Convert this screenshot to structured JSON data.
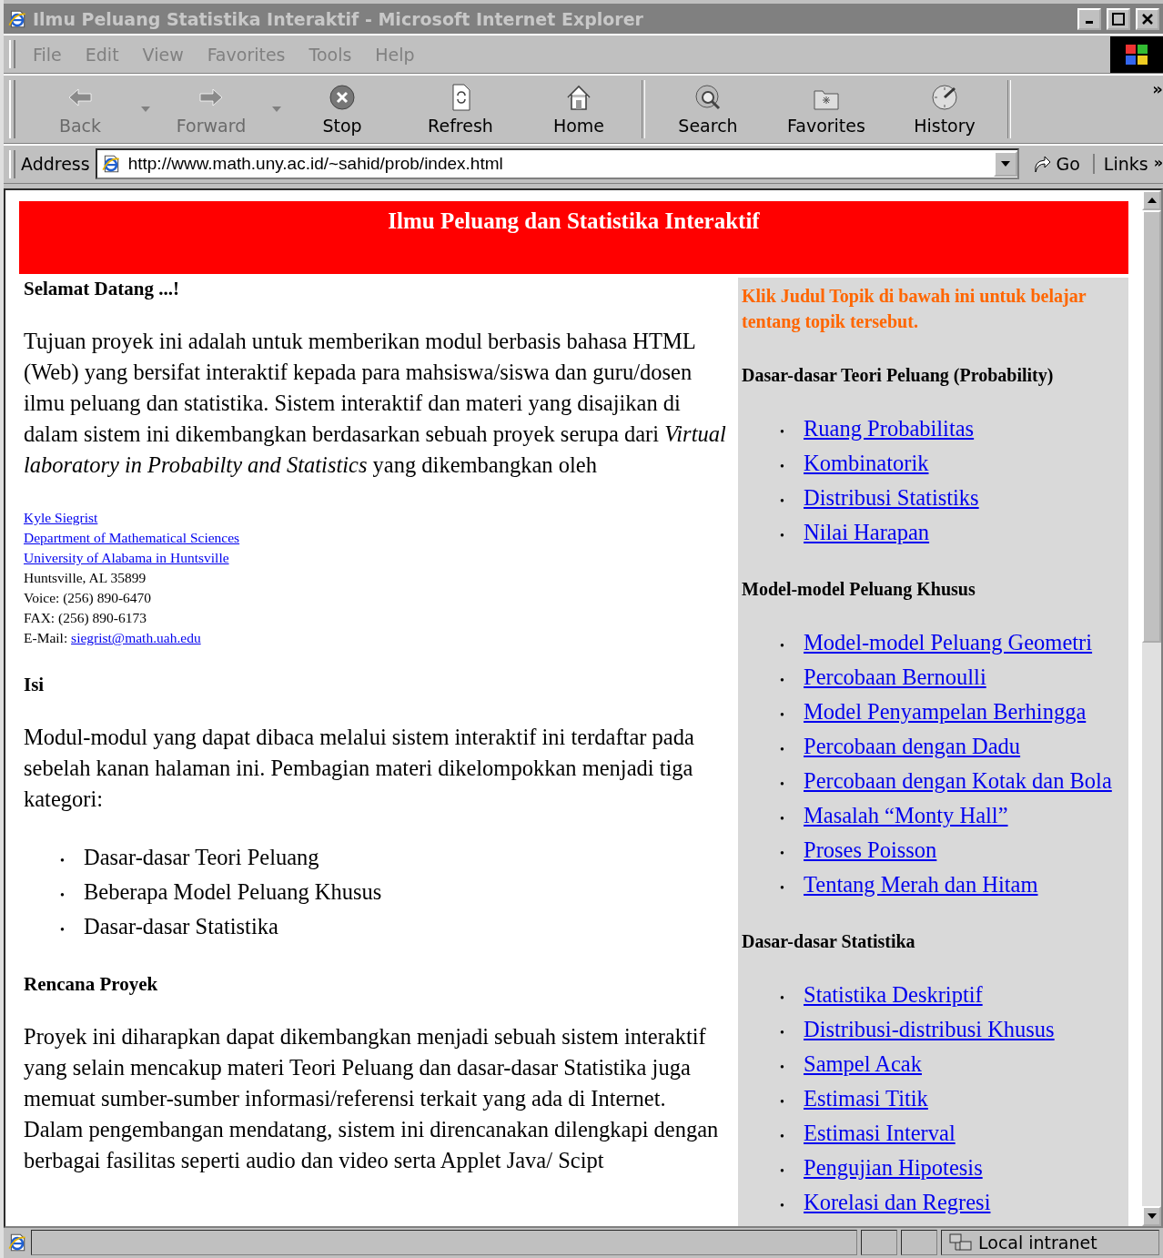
{
  "window": {
    "title": "Ilmu Peluang Statistika Interaktif - Microsoft Internet Explorer"
  },
  "menu": [
    "File",
    "Edit",
    "View",
    "Favorites",
    "Tools",
    "Help"
  ],
  "toolbar": [
    {
      "kind": "button",
      "label": "Back",
      "disabled": true,
      "dropdown": true
    },
    {
      "kind": "button",
      "label": "Forward",
      "disabled": true,
      "dropdown": true
    },
    {
      "kind": "button",
      "label": "Stop",
      "disabled": false,
      "dropdown": false
    },
    {
      "kind": "button",
      "label": "Refresh",
      "disabled": false,
      "dropdown": false
    },
    {
      "kind": "button",
      "label": "Home",
      "disabled": false,
      "dropdown": false
    },
    {
      "kind": "separator"
    },
    {
      "kind": "button",
      "label": "Search",
      "disabled": false,
      "dropdown": false
    },
    {
      "kind": "button",
      "label": "Favorites",
      "disabled": false,
      "dropdown": false
    },
    {
      "kind": "button",
      "label": "History",
      "disabled": false,
      "dropdown": false
    },
    {
      "kind": "separator"
    }
  ],
  "toolbar_more": "»",
  "address_bar": {
    "label": "Address",
    "value": "http://www.math.uny.ac.id/~sahid/prob/index.html",
    "go": "Go",
    "links": "Links",
    "links_more": "»"
  },
  "page": {
    "banner": "Ilmu Peluang dan Statistika Interaktif",
    "left": [
      {
        "kind": "heading",
        "text": "Selamat Datang ...!"
      },
      {
        "kind": "paragraph",
        "text": "Tujuan proyek ini adalah untuk memberikan modul berbasis bahasa HTML (Web) yang bersifat interaktif kepada para mahsiswa/siswa dan guru/dosen ilmu peluang dan statistika. Sistem interaktif dan materi yang disajikan di dalam sistem ini dikembangkan berdasarkan sebuah proyek serupa dari *Virtual laboratory in Probabilty and Statistics* yang dikembangkan oleh"
      },
      {
        "kind": "contact",
        "lines": [
          {
            "kind": "link",
            "text": "Kyle Siegrist"
          },
          {
            "kind": "link",
            "text": "Department of Mathematical Sciences"
          },
          {
            "kind": "link",
            "text": "University of Alabama in Huntsville"
          },
          {
            "kind": "plain",
            "text": "Huntsville, AL 35899"
          },
          {
            "kind": "plain",
            "text": "Voice: (256) 890-6470"
          },
          {
            "kind": "plain",
            "text": "FAX: (256) 890-6173"
          },
          {
            "kind": "mixed",
            "text": "E-Mail:",
            "link": "siegrist@math.uah.edu"
          }
        ]
      },
      {
        "kind": "heading",
        "text": "Isi"
      },
      {
        "kind": "paragraph",
        "text": "Modul-modul yang dapat dibaca melalui sistem interaktif ini terdaftar pada sebelah kanan halaman ini. Pembagian materi dikelompokkan menjadi tiga kategori:"
      },
      {
        "kind": "list",
        "items": [
          {
            "bullet": "•",
            "text": "Dasar-dasar Teori Peluang"
          },
          {
            "bullet": "•",
            "text": "Beberapa Model Peluang Khusus"
          },
          {
            "bullet": "•",
            "text": "Dasar-dasar Statistika"
          }
        ]
      },
      {
        "kind": "heading",
        "text": "Rencana Proyek"
      },
      {
        "kind": "paragraph",
        "text": "Proyek ini diharapkan dapat dikembangkan menjadi sebuah sistem interaktif yang selain mencakup materi Teori Peluang dan dasar-dasar Statistika juga memuat sumber-sumber informasi/referensi terkait yang ada di Internet. Dalam pengembangan mendatang, sistem ini direncanakan dilengkapi dengan berbagai fasilitas seperti audio dan video serta Applet Java/ Scipt"
      }
    ],
    "right": {
      "intro": "Klik Judul Topik di bawah ini untuk belajar tentang topik tersebut.",
      "sections": [
        {
          "title": "Dasar-dasar Teori Peluang (Probability)",
          "links": [
            {
              "bullet": "•",
              "text": "Ruang Probabilitas"
            },
            {
              "bullet": "•",
              "text": "Kombinatorik"
            },
            {
              "bullet": "•",
              "text": "Distribusi Statistiks"
            },
            {
              "bullet": "•",
              "text": "Nilai Harapan"
            }
          ]
        },
        {
          "title": "Model-model Peluang Khusus",
          "links": [
            {
              "bullet": "•",
              "text": "Model-model Peluang Geometri"
            },
            {
              "bullet": "•",
              "text": "Percobaan Bernoulli"
            },
            {
              "bullet": "•",
              "text": "Model Penyampelan Berhingga"
            },
            {
              "bullet": "•",
              "text": "Percobaan dengan Dadu"
            },
            {
              "bullet": "•",
              "text": "Percobaan dengan Kotak dan Bola"
            },
            {
              "bullet": "•",
              "text": "Masalah  “Monty Hall”"
            },
            {
              "bullet": "•",
              "text": "Proses Poisson"
            },
            {
              "bullet": "•",
              "text": "Tentang Merah  dan Hitam"
            }
          ]
        },
        {
          "title": "Dasar-dasar Statistika",
          "links": [
            {
              "bullet": "•",
              "text": "Statistika Deskriptif"
            },
            {
              "bullet": "•",
              "text": "Distribusi-distribusi Khusus"
            },
            {
              "bullet": "•",
              "text": "Sampel Acak"
            },
            {
              "bullet": "•",
              "text": "Estimasi Titik"
            },
            {
              "bullet": "•",
              "text": "Estimasi Interval"
            },
            {
              "bullet": "•",
              "text": "Pengujian Hipotesis"
            },
            {
              "bullet": "•",
              "text": "Korelasi dan Regresi"
            }
          ]
        }
      ]
    }
  },
  "status_bar": {
    "zone": "Local intranet"
  }
}
